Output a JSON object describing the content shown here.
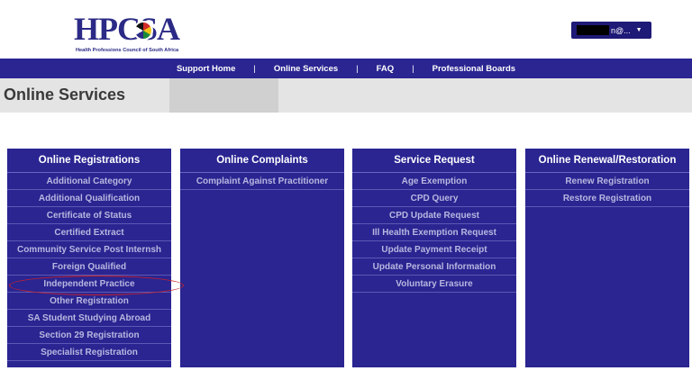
{
  "header": {
    "logo_text": "HPCSA",
    "logo_subtitle": "Health Professions Council of South Africa",
    "user_label": "n@..."
  },
  "nav": {
    "items": [
      "Support Home",
      "Online Services",
      "FAQ",
      "Professional Boards"
    ],
    "separator": "|"
  },
  "page_title": "Online Services",
  "panels": [
    {
      "title": "Online Registrations",
      "items": [
        "Additional Category",
        "Additional Qualification",
        "Certificate of Status",
        "Certified Extract",
        "Community Service Post Internsh",
        "Foreign Qualified",
        "Independent Practice",
        "Other Registration",
        "SA Student Studying Abroad",
        "Section 29 Registration",
        "Specialist Registration"
      ]
    },
    {
      "title": "Online Complaints",
      "items": [
        "Complaint Against Practitioner"
      ]
    },
    {
      "title": "Service Request",
      "items": [
        "Age Exemption",
        "CPD Query",
        "CPD Update Request",
        "Ill Health Exemption Request",
        "Update Payment Receipt",
        "Update Personal Information",
        "Voluntary Erasure"
      ]
    },
    {
      "title": "Online Renewal/Restoration",
      "items": [
        "Renew Registration",
        "Restore Registration"
      ]
    }
  ],
  "colors": {
    "brand": "#2a2591",
    "item_text": "#b9b7e0",
    "highlight": "#c8202b"
  }
}
